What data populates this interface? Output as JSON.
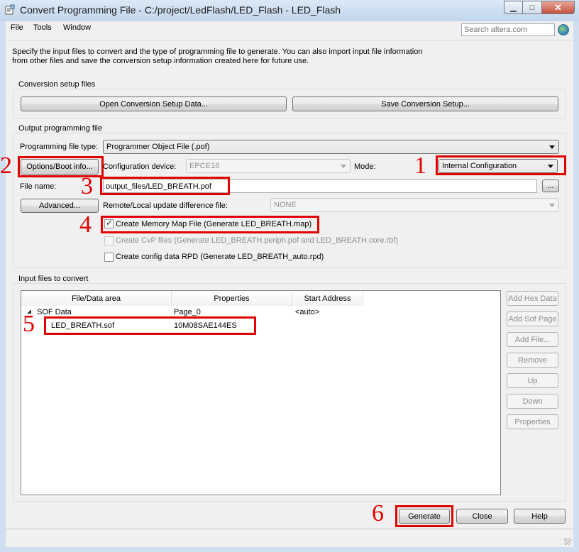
{
  "window": {
    "title": "Convert Programming File - C:/project/LedFlash/LED_Flash - LED_Flash",
    "minimize": "▁",
    "maximize": "□",
    "close": "✕"
  },
  "menu": [
    "File",
    "Tools",
    "Window"
  ],
  "search": {
    "placeholder": "Search altera.com"
  },
  "description": "Specify the input files to convert and the type of programming file to generate. You can also import input file information from other files and save the conversion setup information created here for future use.",
  "setup": {
    "title": "Conversion setup files",
    "open_btn": "Open Conversion Setup Data...",
    "save_btn": "Save Conversion Setup..."
  },
  "output": {
    "title": "Output programming file",
    "type_label": "Programming file type:",
    "type_value": "Programmer Object File (.pof)",
    "options_btn": "Options/Boot info...",
    "device_label": "Configuration device:",
    "device_value": "EPCE16",
    "mode_label": "Mode:",
    "mode_value": "Internal Configuration",
    "filename_label": "File name:",
    "filename_value": "output_files/LED_BREATH.pof",
    "browse_btn": "...",
    "advanced_btn": "Advanced...",
    "remote_label": "Remote/Local update difference file:",
    "remote_value": "NONE",
    "chk_map": "Create Memory Map File (Generate LED_BREATH.map)",
    "chk_cvp": "Create CvP files (Generate LED_BREATH.periph.pof and LED_BREATH.core.rbf)",
    "chk_rpd": "Create config data RPD (Generate LED_BREATH_auto.rpd)"
  },
  "input": {
    "title": "Input files to convert",
    "columns": [
      "File/Data area",
      "Properties",
      "Start Address"
    ],
    "rows": [
      {
        "name": "SOF Data",
        "props": "Page_0",
        "addr": "<auto>"
      },
      {
        "name": "LED_BREATH.sof",
        "props": "10M08SAE144ES",
        "addr": ""
      }
    ],
    "side_buttons": [
      "Add Hex Data",
      "Add Sof Page",
      "Add File...",
      "Remove",
      "Up",
      "Down",
      "Properties"
    ]
  },
  "footer": {
    "generate": "Generate",
    "close": "Close",
    "help": "Help"
  },
  "annotations": [
    "1",
    "2",
    "3",
    "4",
    "5",
    "6"
  ],
  "colors": {
    "highlight": "#e00000",
    "window_frame": "#cfdff0"
  }
}
